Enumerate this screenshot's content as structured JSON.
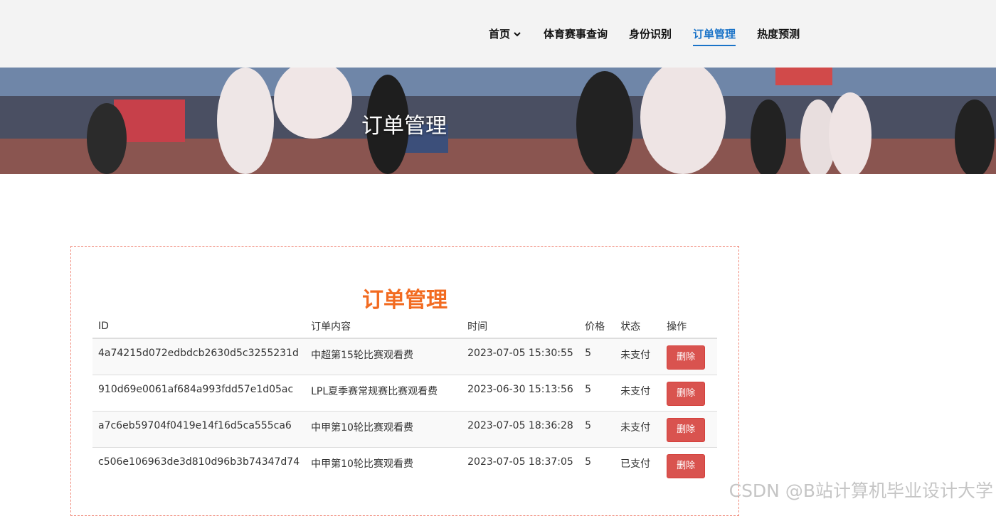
{
  "nav": {
    "items": [
      {
        "label": "首页"
      },
      {
        "label": "体育赛事查询"
      },
      {
        "label": "身份识别"
      },
      {
        "label": "订单管理"
      },
      {
        "label": "热度预测"
      }
    ],
    "active_color": "#1a73c8"
  },
  "banner": {
    "title": "订单管理"
  },
  "card": {
    "title": "订单管理",
    "title_color": "#f26b21",
    "columns": [
      "ID",
      "订单内容",
      "时间",
      "价格",
      "状态",
      "操作"
    ],
    "rows": [
      {
        "id": "4a74215d072edbdcb2630d5c3255231d",
        "content": "中超第15轮比赛观看费",
        "time": "2023-07-05 15:30:55",
        "price": "5",
        "status": "未支付",
        "action": "删除"
      },
      {
        "id": "910d69e0061af684a993fdd57e1d05ac",
        "content": "LPL夏季赛常规赛比赛观看费",
        "time": "2023-06-30 15:13:56",
        "price": "5",
        "status": "未支付",
        "action": "删除"
      },
      {
        "id": "a7c6eb59704f0419e14f16d5ca555ca6",
        "content": "中甲第10轮比赛观看费",
        "time": "2023-07-05 18:36:28",
        "price": "5",
        "status": "未支付",
        "action": "删除"
      },
      {
        "id": "c506e106963de3d810d96b3b74347d74",
        "content": "中甲第10轮比赛观看费",
        "time": "2023-07-05 18:37:05",
        "price": "5",
        "status": "已支付",
        "action": "删除"
      }
    ],
    "delete_color": "#d9534f"
  },
  "watermark": "CSDN @B站计算机毕业设计大学"
}
